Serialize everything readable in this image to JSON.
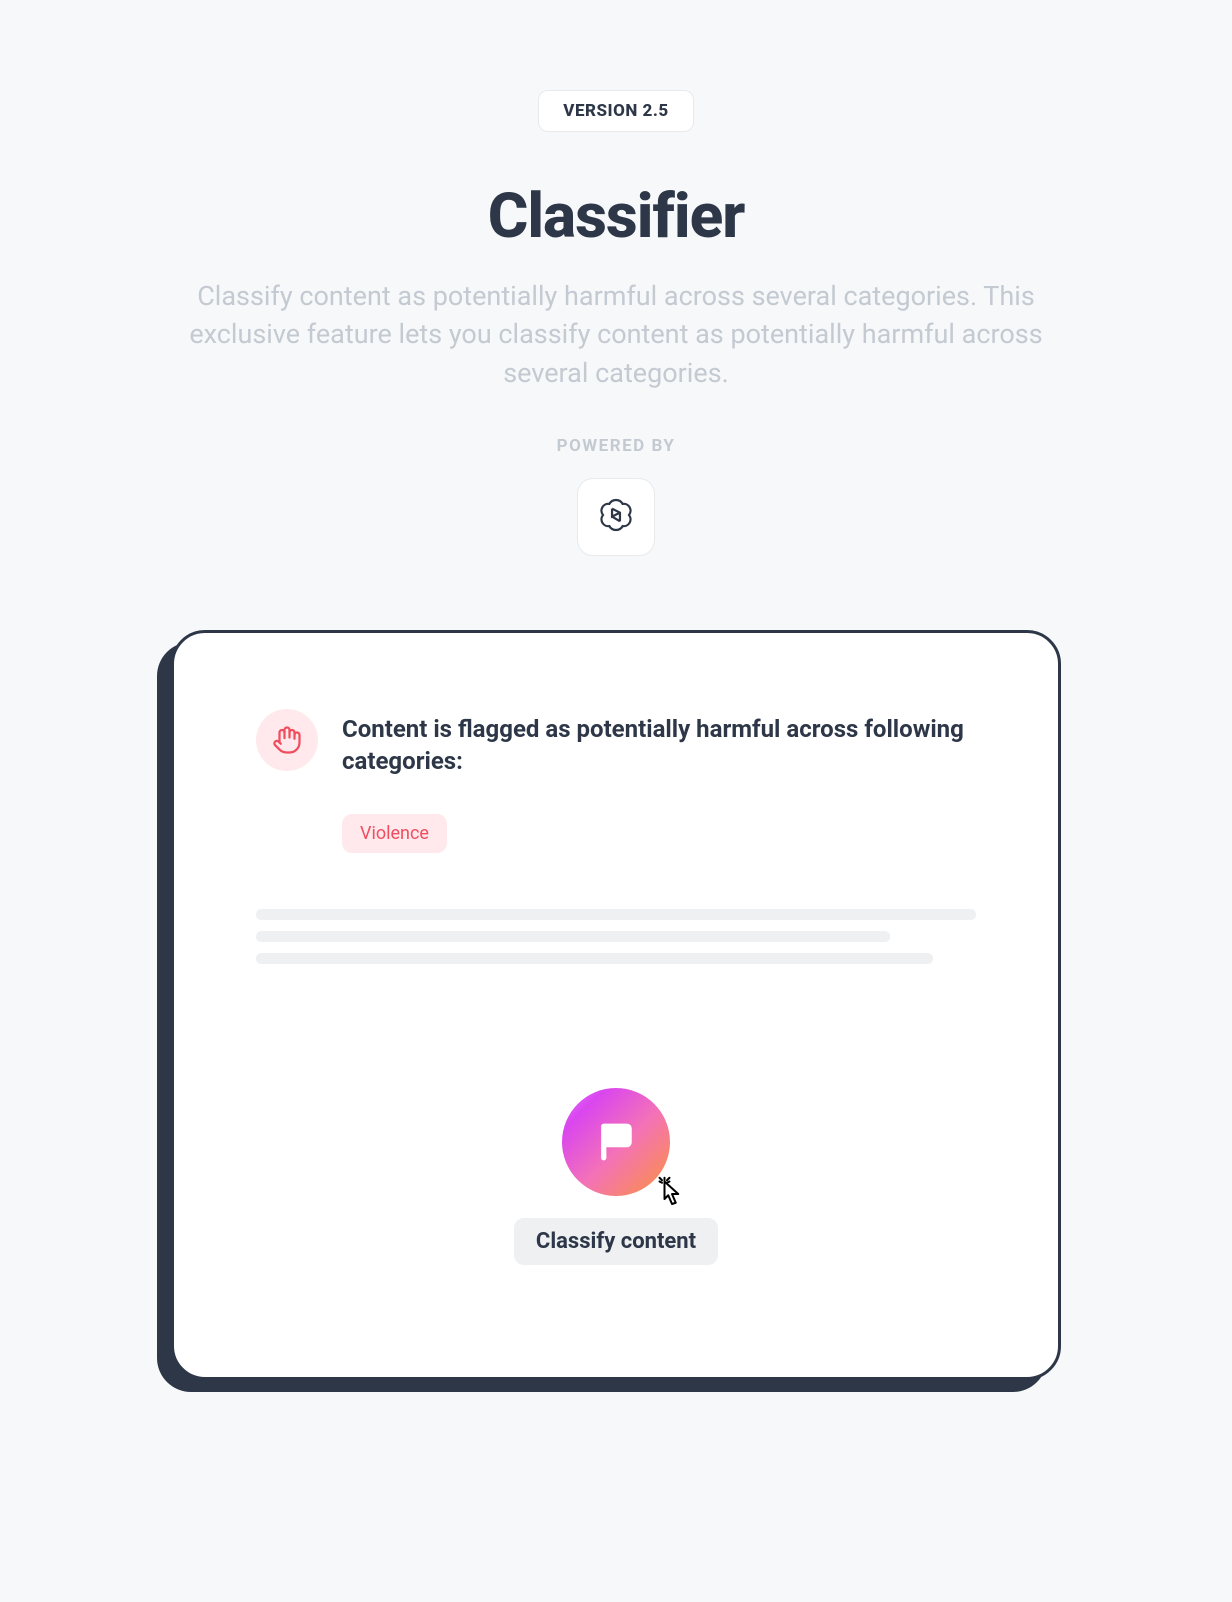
{
  "header": {
    "version_label": "VERSION 2.5",
    "title": "Classifier",
    "description": "Classify content as potentially harmful across several categories. This exclusive feature lets you classify content as potentially harmful across several categories.",
    "powered_by": "POWERED BY"
  },
  "card": {
    "flag_message": "Content is flagged as potentially harmful across following categories:",
    "categories": [
      "Violence"
    ],
    "action_label": "Classify content"
  }
}
